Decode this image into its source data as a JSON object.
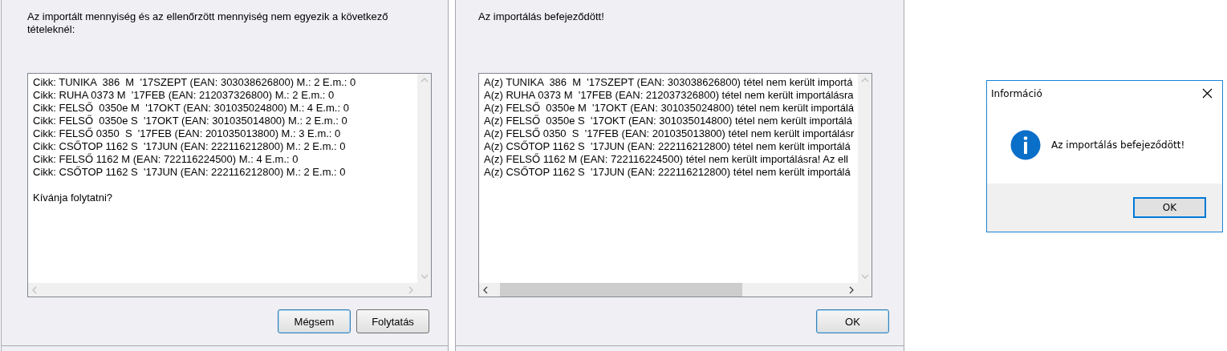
{
  "dialogs": [
    {
      "message": "Az importált mennyiség és az ellenőrzött mennyiség nem egyezik a következő tételeknél:",
      "list": {
        "h_scroll_enabled": false,
        "lines": [
          "Cikk: TUNIKA  386  M  '17SZEPT (EAN: 303038626800) M.: 2 E.m.: 0",
          "Cikk: RUHA 0373 M  '17FEB (EAN: 212037326800) M.: 2 E.m.: 0",
          "Cikk: FELSŐ  0350e M  '17OKT (EAN: 301035024800) M.: 4 E.m.: 0",
          "Cikk: FELSŐ  0350e S  '17OKT (EAN: 301035014800) M.: 2 E.m.: 0",
          "Cikk: FELSŐ 0350  S  '17FEB (EAN: 201035013800) M.: 3 E.m.: 0",
          "Cikk: CSŐTOP 1162 S  '17JUN (EAN: 222116212800) M.: 2 E.m.: 0",
          "Cikk: FELSŐ 1162 M (EAN: 722116224500) M.: 4 E.m.: 0",
          "Cikk: CSŐTOP 1162 S  '17JUN (EAN: 222116212800) M.: 2 E.m.: 0"
        ],
        "closing_line": "Kívánja folytatni?"
      },
      "buttons": [
        {
          "label": "Mégsem",
          "default": true
        },
        {
          "label": "Folytatás",
          "default": false
        }
      ]
    },
    {
      "message": "Az importálás befejeződött!",
      "list": {
        "h_scroll_enabled": true,
        "lines": [
          "A(z) TUNIKA  386  M  '17SZEPT (EAN: 303038626800) tétel nem került importá",
          "A(z) RUHA 0373 M  '17FEB (EAN: 212037326800) tétel nem került importálásra",
          "A(z) FELSŐ  0350e M  '17OKT (EAN: 301035024800) tétel nem került importálá",
          "A(z) FELSŐ  0350e S  '17OKT (EAN: 301035014800) tétel nem került importálá",
          "A(z) FELSŐ 0350  S  '17FEB (EAN: 201035013800) tétel nem került importálásr",
          "A(z) CSŐTOP 1162 S  '17JUN (EAN: 222116212800) tétel nem került importálá",
          "A(z) FELSŐ 1162 M (EAN: 722116224500) tétel nem került importálásra! Az ell",
          "A(z) CSŐTOP 1162 S  '17JUN (EAN: 222116212800) tétel nem került importálá"
        ]
      },
      "buttons": [
        {
          "label": "OK",
          "default": true
        }
      ]
    }
  ],
  "info_dialog": {
    "title": "Információ",
    "message": "Az importálás befejeződött!",
    "buttons": [
      {
        "label": "OK",
        "default": true
      }
    ]
  }
}
